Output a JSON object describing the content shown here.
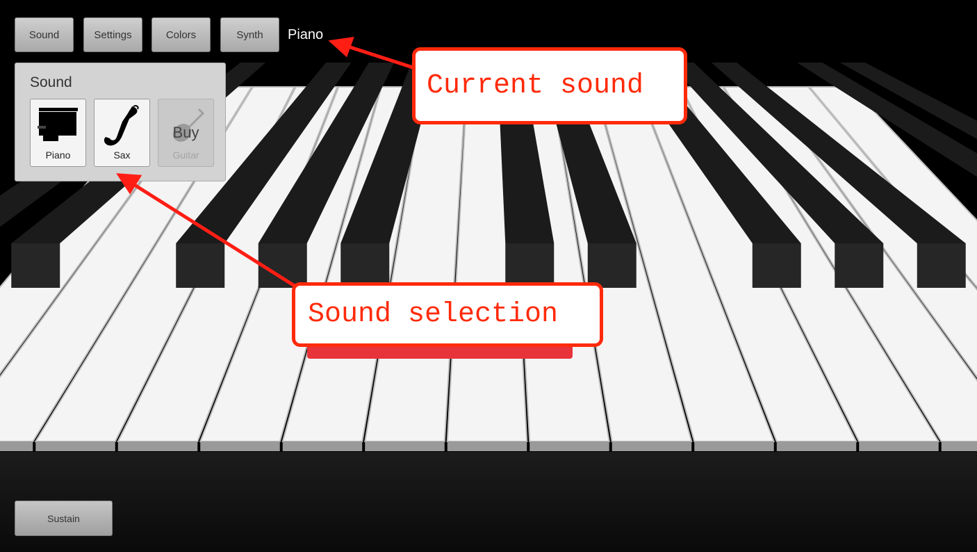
{
  "toolbar": {
    "sound_label": "Sound",
    "settings_label": "Settings",
    "colors_label": "Colors",
    "synth_label": "Synth",
    "current_sound": "Piano"
  },
  "sound_panel": {
    "title": "Sound",
    "options": [
      {
        "label": "Piano",
        "icon": "piano-icon"
      },
      {
        "label": "Sax",
        "icon": "saxophone-icon"
      },
      {
        "label": "Guitar",
        "icon": "guitar-icon",
        "badge": "Buy",
        "locked": true
      }
    ]
  },
  "sustain_label": "Sustain",
  "annotations": {
    "current_sound": "Current sound",
    "sound_selection": "Sound selection"
  },
  "colors": {
    "callout": "#ff2a0a",
    "highlighted_key": "#e8333a",
    "background": "#000000"
  }
}
